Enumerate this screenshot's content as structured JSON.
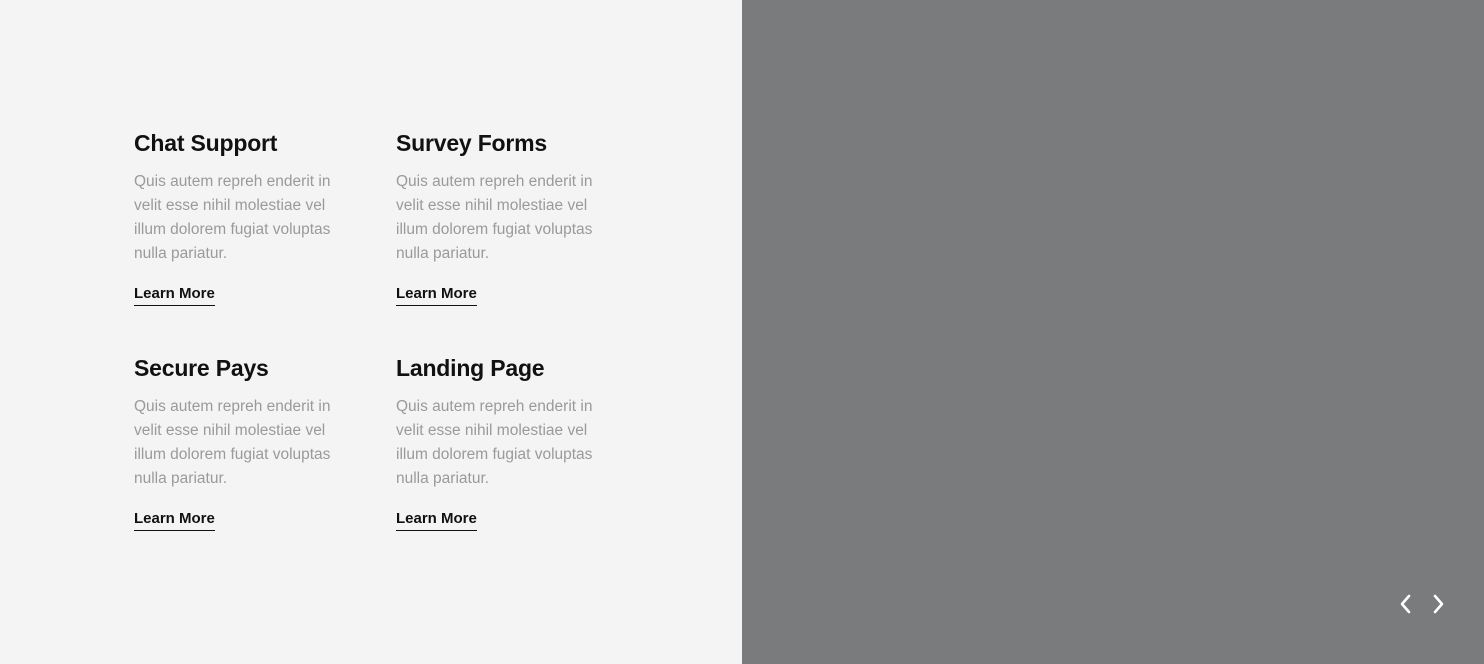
{
  "features": [
    {
      "title": "Chat Support",
      "description": "Quis autem repreh enderit in velit esse nihil molestiae vel illum dolorem fugiat voluptas nulla pariatur.",
      "link_label": "Learn More"
    },
    {
      "title": "Survey Forms",
      "description": "Quis autem repreh enderit in velit esse nihil molestiae vel illum dolorem fugiat voluptas nulla pariatur.",
      "link_label": "Learn More"
    },
    {
      "title": "Secure Pays",
      "description": "Quis autem repreh enderit in velit esse nihil molestiae vel illum dolorem fugiat voluptas nulla pariatur.",
      "link_label": "Learn More"
    },
    {
      "title": "Landing Page",
      "description": "Quis autem repreh enderit in velit esse nihil molestiae vel illum dolorem fugiat voluptas nulla pariatur.",
      "link_label": "Learn More"
    }
  ],
  "slider": {
    "prev_icon": "chevron-left-icon",
    "next_icon": "chevron-right-icon"
  },
  "colors": {
    "left_background": "#f4f4f4",
    "right_background": "#7a7b7d",
    "title": "#111111",
    "description": "#9a9a9a",
    "nav_icon": "#ffffff"
  }
}
